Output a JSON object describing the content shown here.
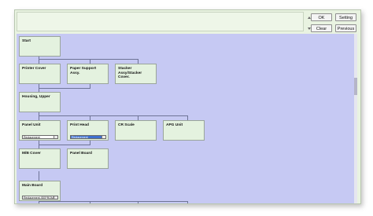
{
  "toolbar": {
    "ok": "OK",
    "setting": "Setting",
    "clear": "Clear",
    "previous": "Previous"
  },
  "nodes": {
    "start": "Start",
    "printer_cover": "Printer Cover",
    "paper_support": "Paper Support Assy.",
    "stacker": "Stacker Assy/Stacker Cover.",
    "housing_upper": "Housing, Upper",
    "panel_unit": "Panel Unit",
    "print_head": "Print Head",
    "cr_scale": "CR Scale",
    "apg_unit": "APG Unit",
    "mb_cover": "M/B Cover",
    "panel_board": "Panel Board",
    "main_board": "Main Board"
  },
  "selects": {
    "panel_unit": "Replacement",
    "print_head": "Replacement",
    "main_board": "Replacement (EEPROM C"
  }
}
